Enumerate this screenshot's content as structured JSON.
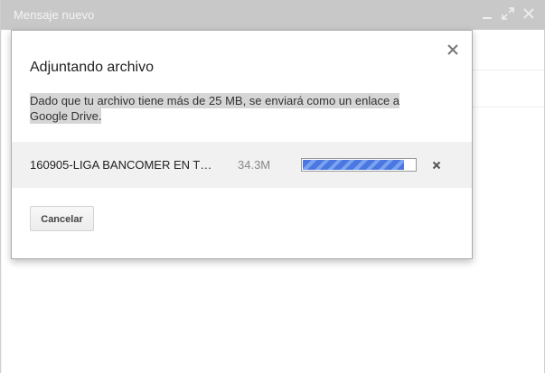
{
  "compose": {
    "title": "Mensaje nuevo"
  },
  "icons": {
    "minimize": "minimize-icon",
    "expand": "expand-icon",
    "close": "close-icon"
  },
  "dialog": {
    "title": "Adjuntando archivo",
    "message": "Dado que tu archivo tiene más de 25 MB, se enviará como un enlace a Google Drive.",
    "file": {
      "name": "160905-LIGA BANCOMER EN T…",
      "size": "34.3M",
      "progress": 0.9
    },
    "cancel_label": "Cancelar"
  },
  "colors": {
    "header_bg": "#c8c8c8",
    "progress_fill": "#4a78e0",
    "upload_row_bg": "#f1f1f1"
  }
}
